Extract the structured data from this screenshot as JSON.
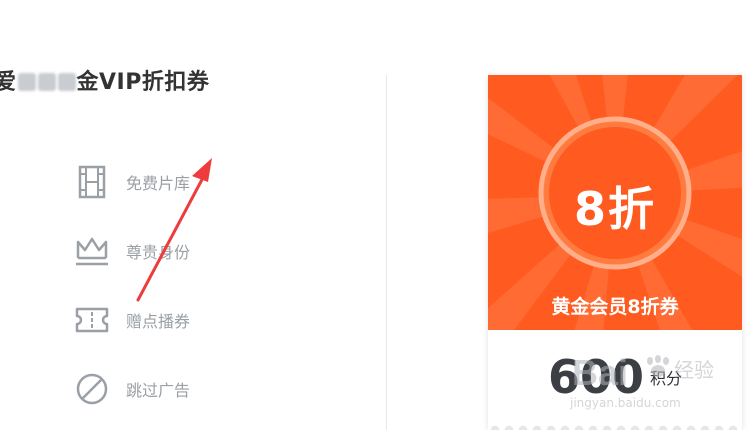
{
  "page": {
    "title_prefix": "爱",
    "title_suffix": "金VIP折扣券"
  },
  "benefits": [
    {
      "icon": "film-icon",
      "label": "免费片库"
    },
    {
      "icon": "crown-icon",
      "label": "尊贵身份"
    },
    {
      "icon": "ticket-icon",
      "label": "赠点播券"
    },
    {
      "icon": "no-ads-icon",
      "label": "跳过广告"
    }
  ],
  "coupon": {
    "discount_label": "8折",
    "name": "黄金会员8折券",
    "points_value": "600",
    "points_unit": "积分"
  },
  "colors": {
    "card_bg": "#ff5a1f",
    "annotation_arrow": "#ee3b3b",
    "icon_gray": "#9aa0a6"
  },
  "watermark": {
    "brand": "Bai",
    "brand_cn": "经验",
    "url": "jingyan.baidu.com"
  }
}
